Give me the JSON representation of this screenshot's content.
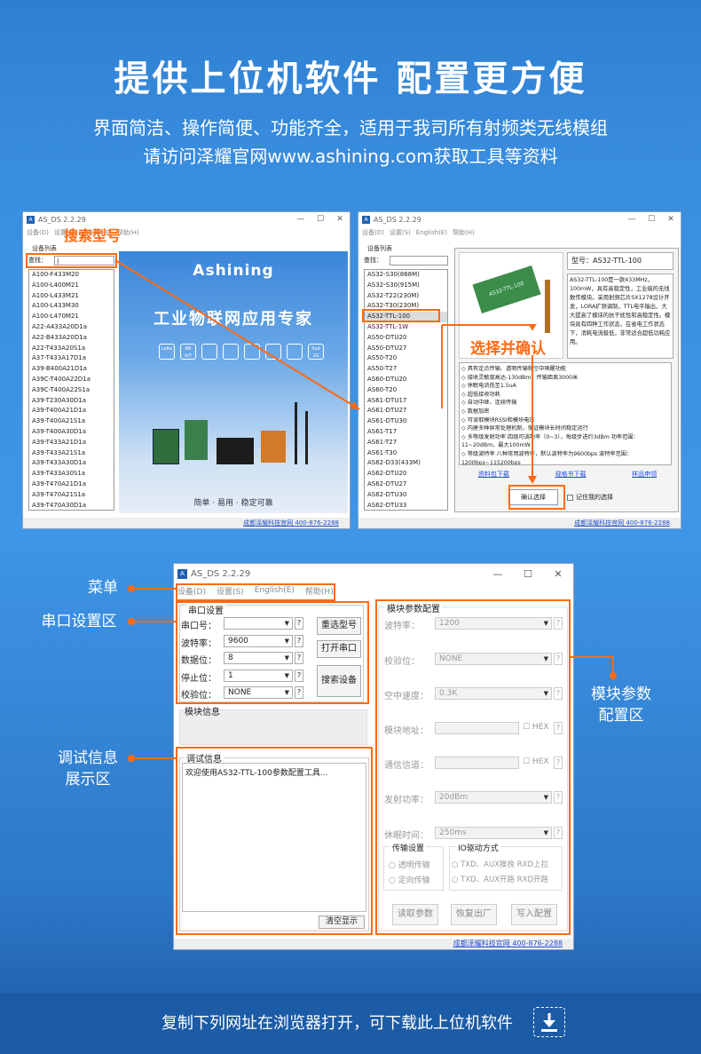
{
  "header": {
    "title": "提供上位机软件  配置更方便",
    "sub1": "界面简洁、操作简便、功能齐全，适用于我司所有射频类无线模组",
    "sub2": "请访问泽耀官网www.ashining.com获取工具等资料"
  },
  "left_window": {
    "title": "AS_DS 2.2.29",
    "menu": [
      "设备(D)",
      "设置(S)",
      "English(E)",
      "帮助(H)"
    ],
    "device_list_label": "设备列表",
    "search_label": "查找：",
    "devices": [
      "A100-F433M20",
      "A100-L400M21",
      "A100-L433M21",
      "A100-L433M30",
      "A100-L470M21",
      "A22-A433A20D1a",
      "A22-B433A20D1a",
      "A22-T433A20S1a",
      "A37-T433A17D1a",
      "A39-B400A21D1a",
      "A39C-T400A22D1a",
      "A39C-T400A22S1a",
      "A39-T230A30D1a",
      "A39-T400A21D1a",
      "A39-T400A21S1a",
      "A39-T400A30D1a",
      "A39-T433A21D1a",
      "A39-T433A21S1a",
      "A39-T433A30D1a",
      "A39-T433A30S1a",
      "A39-T470A21D1a",
      "A39-T470A21S1a",
      "A39-T470A30D1a"
    ],
    "banner_brand": "Ashining",
    "banner_slogan": "工业物联网应用专家",
    "banner_tag_chars": [
      "LoRa",
      "NB IoT",
      "",
      "",
      "",
      "",
      "",
      "Sub 1G"
    ],
    "banner_footer": "简单 · 易用 · 稳定可靠",
    "status_link": "成都泽耀科技官网 400-876-2288",
    "annotation": "搜索型号"
  },
  "right_window": {
    "title": "AS_DS 2.2.29",
    "menu": [
      "设备(D)",
      "设置(S)",
      "English(E)",
      "帮助(H)"
    ],
    "device_list_label": "设备列表",
    "search_label": "查找：",
    "devices": [
      "AS32-S30(868M)",
      "AS32-S30(915M)",
      "AS32-T22(230M)",
      "AS32-T30(230M)",
      "AS32-TTL-100",
      "AS32-TTL-1W",
      "AS50-DTU20",
      "AS50-DTU27",
      "AS50-T20",
      "AS50-T27",
      "AS60-DTU20",
      "AS60-T20",
      "AS61-DTU17",
      "AS61-DTU27",
      "AS61-DTU30",
      "AS61-T17",
      "AS61-T27",
      "AS61-T30",
      "AS62-D33(433M)",
      "AS62-DTU20",
      "AS62-DTU27",
      "AS62-DTU30",
      "AS62-DTU33"
    ],
    "selected_index": 4,
    "model_label": "型号：AS32-TTL-100",
    "description": "AS32-TTL-100是一款433MHz，100mW，具有高稳定性，工业级的无线数传模块。采用射频芯片SX1278设计开发，LORA扩频调制，TTL电平输出，大大提高了模块的抗干扰性和高稳定性。模块具有四种工作状态，在省电工作状态下，消耗电流极低，非常适合超低功耗应用。",
    "features": [
      "◇ 具有定点传输、透明传输和空中唤醒功能",
      "◇ 接收灵敏度高达-130dBm，传输距离3000米",
      "◇ 休眠电流低至1.5uA",
      "◇ 超低接收功耗",
      "◇ 自动中继、连续传输",
      "◇ 数据加密",
      "◇ 可读取模块RSSI和模块电压",
      "◇ 内建多种异常处理机制，保证模块长时间稳定运行",
      "◇ 多等级发射功率 四级可调功率（0~3），每级步进约3dBm 功率范围：11~20dBm，最大100mW",
      "◇ 等级波特率 八种常用波特率，默认波特率为9600bps 波特率范围：1200bps~115200bps"
    ],
    "links": [
      "资料包下载",
      "规格书下载",
      "样品申领"
    ],
    "confirm_button": "确认选择",
    "remember_label": "记住我的选择",
    "status_link": "成都泽耀科技官网 400-876-2288",
    "annotation": "选择并确认",
    "chip_text": "AS32-TTL-100"
  },
  "big_window": {
    "title": "AS_DS 2.2.29",
    "menu": [
      "设备(D)",
      "设置(S)",
      "English(E)",
      "帮助(H)"
    ],
    "serial_group": "串口设置",
    "serial_rows": [
      {
        "label": "串口号：",
        "value": ""
      },
      {
        "label": "波特率：",
        "value": "9600"
      },
      {
        "label": "数据位：",
        "value": "8"
      },
      {
        "label": "停止位：",
        "value": "1"
      },
      {
        "label": "校验位：",
        "value": "NONE"
      }
    ],
    "btn_reselect": "重选型号",
    "btn_open": "打开串口",
    "btn_search": "搜索设备",
    "module_info": "模块信息",
    "debug_info": "调试信息",
    "debug_text": "欢迎使用AS32-TTL-100参数配置工具...",
    "btn_clear": "清空显示",
    "param_group": "模块参数配置",
    "params": [
      {
        "label": "波特率：",
        "value": "1200"
      },
      {
        "label": "校验位：",
        "value": "NONE"
      },
      {
        "label": "空中速度：",
        "value": "0.3K"
      },
      {
        "label": "模块地址：",
        "value": "",
        "hex": "HEX"
      },
      {
        "label": "通信信道：",
        "value": "",
        "hex": "HEX"
      },
      {
        "label": "发射功率：",
        "value": "20dBm"
      },
      {
        "label": "休眠时间：",
        "value": "250ms"
      }
    ],
    "transfer_group": "传输设置",
    "transfer_opts": [
      "透明传输",
      "定向传输"
    ],
    "io_group": "IO驱动方式",
    "io_opts": [
      "TXD、AUX推挽 RXD上拉",
      "TXD、AUX开路 RXD开路"
    ],
    "btn_read": "读取参数",
    "btn_reset": "恢复出厂",
    "btn_write": "写入配置",
    "status_link": "成都泽耀科技官网 400-876-2288"
  },
  "callouts": {
    "menu": "菜单",
    "serial": "串口设置区",
    "debug": "调试信息\n展示区",
    "param": "模块参数\n配置区"
  },
  "footer": {
    "text": "复制下列网址在浏览器打开，可下载此上位机软件"
  },
  "colors": {
    "accent": "#ff6a13",
    "bg": "#3a8ee0",
    "footer_bg": "#1c5ba6"
  }
}
